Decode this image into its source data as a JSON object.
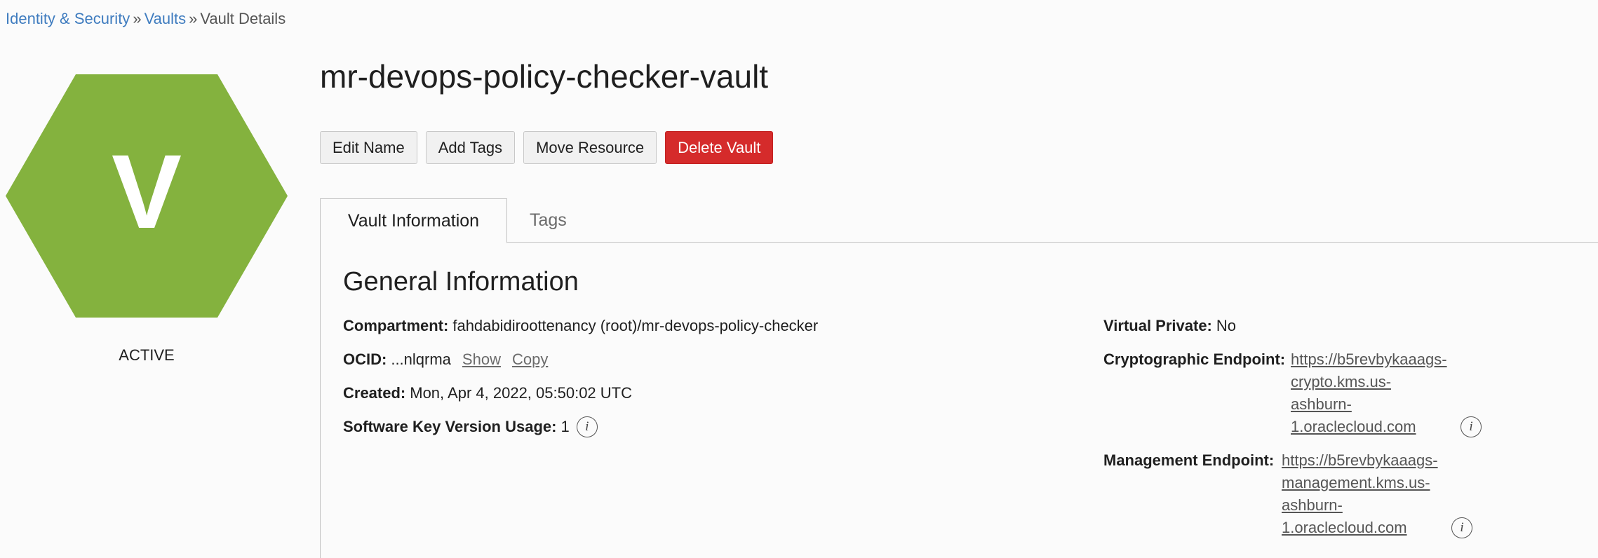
{
  "breadcrumb": {
    "item1": "Identity & Security",
    "item2": "Vaults",
    "item3": "Vault Details",
    "separator": "»"
  },
  "resource": {
    "icon_letter": "V",
    "state": "ACTIVE",
    "icon_color": "#84b23e"
  },
  "title": "mr-devops-policy-checker-vault",
  "actions": {
    "edit_name": "Edit Name",
    "add_tags": "Add Tags",
    "move_resource": "Move Resource",
    "delete_vault": "Delete Vault"
  },
  "tabs": {
    "vault_information": "Vault Information",
    "tags": "Tags"
  },
  "general": {
    "section_title": "General Information",
    "compartment_label": "Compartment:",
    "compartment_value": "fahdabidiroottenancy (root)/mr-devops-policy-checker",
    "ocid_label": "OCID:",
    "ocid_value": "...nlqrma",
    "ocid_show": "Show",
    "ocid_copy": "Copy",
    "created_label": "Created:",
    "created_value": "Mon, Apr 4, 2022, 05:50:02 UTC",
    "skvu_label": "Software Key Version Usage:",
    "skvu_value": "1",
    "virtual_private_label": "Virtual Private:",
    "virtual_private_value": "No",
    "crypto_label": "Cryptographic Endpoint:",
    "crypto_lines": [
      "https://b5revbykaaags-",
      "crypto.kms.us-",
      "ashburn-",
      "1.oraclecloud.com"
    ],
    "mgmt_label": "Management Endpoint:",
    "mgmt_lines": [
      "https://b5revbykaaags-",
      "management.kms.us-",
      "ashburn-",
      "1.oraclecloud.com"
    ]
  },
  "colors": {
    "link": "#3f7cbf",
    "danger": "#d52b2b"
  },
  "icons": {
    "info": "info-circle-icon"
  }
}
